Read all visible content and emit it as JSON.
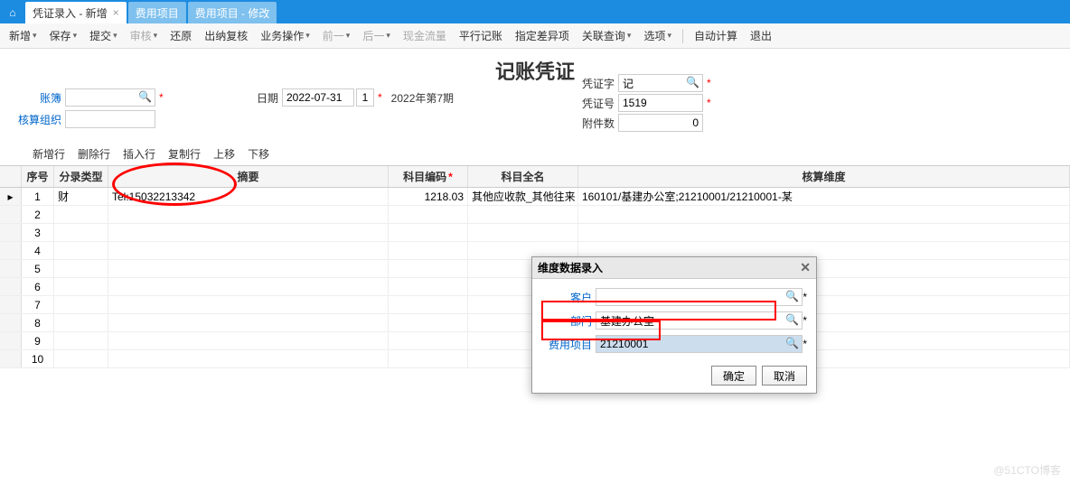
{
  "tabs": {
    "home_icon": "⌂",
    "items": [
      {
        "label": "凭证录入 - 新增",
        "active": true
      },
      {
        "label": "费用项目",
        "active": false
      },
      {
        "label": "费用项目 - 修改",
        "active": false
      }
    ],
    "close": "×"
  },
  "toolbar": {
    "new": "新增",
    "save": "保存",
    "submit": "提交",
    "audit": "审核",
    "restore": "还原",
    "travel": "出纳复核",
    "biz": "业务操作",
    "prev": "前一",
    "next": "后一",
    "cash": "现金流量",
    "parallel": "平行记账",
    "diff": "指定差异项",
    "relq": "关联查询",
    "option": "选项",
    "auto": "自动计算",
    "exit": "退出",
    "caret": "▾"
  },
  "title": "记账凭证",
  "form": {
    "book_label": "账簿",
    "book_value": " ",
    "org_label": "核算组织",
    "org_value": " ",
    "date_label": "日期",
    "date_value": "2022-07-31",
    "date_btn": "1",
    "period": "2022年第7期",
    "vword_label": "凭证字",
    "vword_value": "记",
    "vnum_label": "凭证号",
    "vnum_value": "1519",
    "attach_label": "附件数",
    "attach_value": "0",
    "ast": "*"
  },
  "grid_toolbar": {
    "add": "新增行",
    "del": "删除行",
    "ins": "插入行",
    "copy": "复制行",
    "up": "上移",
    "down": "下移"
  },
  "grid": {
    "headers": {
      "idx": "序号",
      "type": "分录类型",
      "summary": "摘要",
      "code": "科目编码",
      "name": "科目全名",
      "dim": "核算维度"
    },
    "ast": "*",
    "rows": [
      {
        "idx": "1",
        "type": "财",
        "summary": "Tel:15032213342",
        "code": "1218.03",
        "name": "其他应收款_其他往来",
        "dim": "160101/基建办公室;21210001/21210001-某　　　"
      },
      {
        "idx": "2"
      },
      {
        "idx": "3"
      },
      {
        "idx": "4"
      },
      {
        "idx": "5"
      },
      {
        "idx": "6"
      },
      {
        "idx": "7"
      },
      {
        "idx": "8"
      },
      {
        "idx": "9"
      },
      {
        "idx": "10"
      }
    ],
    "marker": "▸"
  },
  "dialog": {
    "title": "维度数据录入",
    "close": "✕",
    "cust_label": "客户",
    "cust_value": "",
    "dept_label": "部门",
    "dept_value": "基建办公室",
    "fee_label": "费用项目",
    "fee_value": "21210001",
    "ok": "确定",
    "cancel": "取消",
    "ast": "*"
  },
  "watermark": "@51CTO博客",
  "mag": "🔍"
}
